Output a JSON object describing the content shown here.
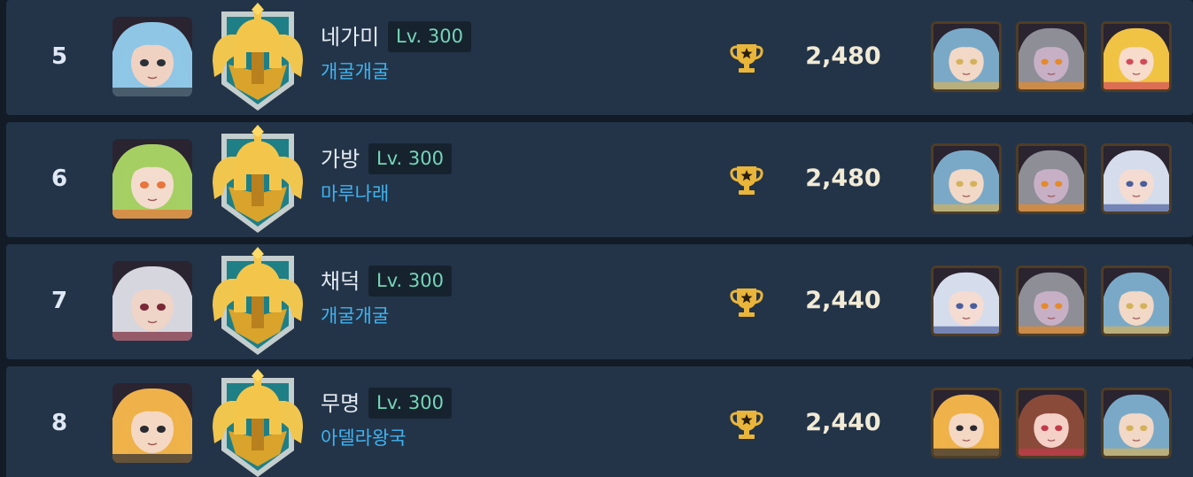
{
  "rows": [
    {
      "rank": "5",
      "name": "네가미",
      "level": "Lv. 300",
      "guild": "개굴개굴",
      "score": "2,480",
      "avatar": {
        "hair": "#8fc6e6",
        "skin": "#f0d2c2",
        "accent": "#2b2f38"
      },
      "heroes": [
        {
          "hair": "#7aa9c8",
          "skin": "#f2d8c6",
          "accent": "#d3b25c"
        },
        {
          "hair": "#8e8e96",
          "skin": "#c7b0c6",
          "accent": "#e58a2b"
        },
        {
          "hair": "#f0c344",
          "skin": "#f7dccb",
          "accent": "#d14a5a"
        }
      ]
    },
    {
      "rank": "6",
      "name": "가방",
      "level": "Lv. 300",
      "guild": "마루나래",
      "score": "2,480",
      "avatar": {
        "hair": "#a6cf63",
        "skin": "#f3dccd",
        "accent": "#e9753d"
      },
      "heroes": [
        {
          "hair": "#7aa9c8",
          "skin": "#f2d8c6",
          "accent": "#d3b25c"
        },
        {
          "hair": "#8e8e96",
          "skin": "#c7b0c6",
          "accent": "#e58a2b"
        },
        {
          "hair": "#d5dcec",
          "skin": "#f4dcd2",
          "accent": "#4a5e9c"
        }
      ]
    },
    {
      "rank": "7",
      "name": "채덕",
      "level": "Lv. 300",
      "guild": "개굴개굴",
      "score": "2,440",
      "avatar": {
        "hair": "#d6d6de",
        "skin": "#efd4c8",
        "accent": "#7a2738"
      },
      "heroes": [
        {
          "hair": "#d5dcec",
          "skin": "#f4dcd2",
          "accent": "#4a5e9c"
        },
        {
          "hair": "#8e8e96",
          "skin": "#c7b0c6",
          "accent": "#e58a2b"
        },
        {
          "hair": "#7aa9c8",
          "skin": "#f2d8c6",
          "accent": "#d3b25c"
        }
      ]
    },
    {
      "rank": "8",
      "name": "무명",
      "level": "Lv. 300",
      "guild": "아델라왕국",
      "score": "2,440",
      "avatar": {
        "hair": "#efb24a",
        "skin": "#f5d8c3",
        "accent": "#2a2a30"
      },
      "heroes": [
        {
          "hair": "#efb24a",
          "skin": "#f5d8c3",
          "accent": "#2a2a30"
        },
        {
          "hair": "#8a4a3a",
          "skin": "#f4d0c6",
          "accent": "#c23b4a"
        },
        {
          "hair": "#7aa9c8",
          "skin": "#f2d8c6",
          "accent": "#d3b25c"
        }
      ]
    }
  ],
  "icons": {
    "trophy": "trophy-icon",
    "emblem": "gold-helmet-emblem"
  },
  "colors": {
    "row_bg": "#233449",
    "level_text": "#73d6b6",
    "guild_text": "#3fb3f0",
    "score_text": "#f1ead5",
    "gold": "#e9b53a"
  }
}
